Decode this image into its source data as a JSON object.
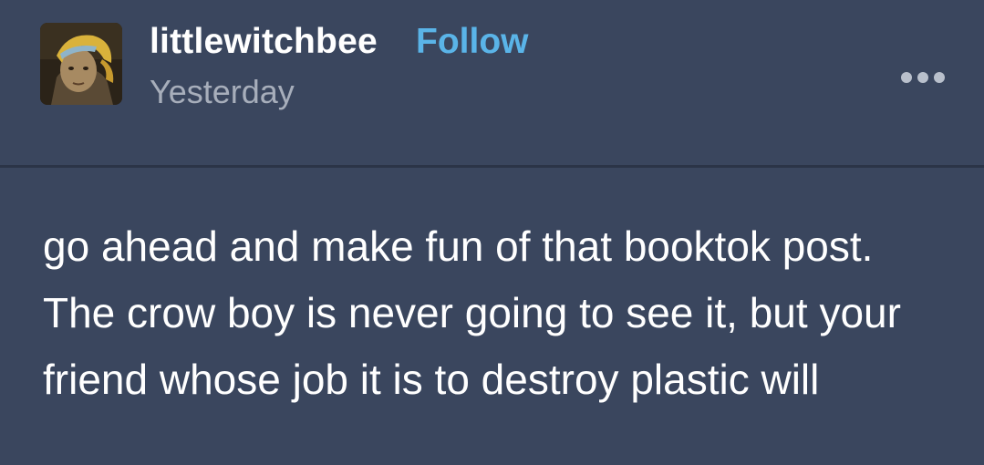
{
  "post": {
    "username": "littlewitchbee",
    "follow_label": "Follow",
    "timestamp": "Yesterday",
    "more_icon": "ellipsis-icon",
    "body_text": "go ahead and make fun of that booktok post. The crow boy is never going to see it, but your friend whose job it is to destroy plastic will"
  },
  "colors": {
    "background": "#3a465e",
    "username": "#ffffff",
    "follow": "#5ab4e8",
    "timestamp": "#a7aebb",
    "divider": "#2b3447"
  }
}
